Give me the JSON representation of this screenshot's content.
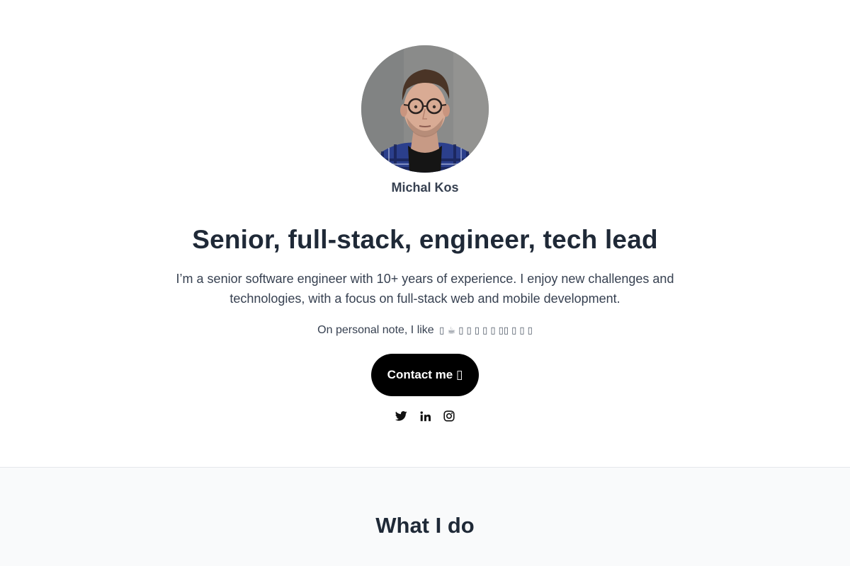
{
  "profile": {
    "name": "Michal Kos"
  },
  "hero": {
    "headline": "Senior, full-stack, engineer, tech lead",
    "intro": "I’m a senior software engineer with 10+ years of experience. I enjoy new challenges and technologies, with a focus on full-stack web and mobile development.",
    "personal_prefix": "On personal note, I like",
    "personal_emojis": "▯ ☕ ▯ ▯ ▯ ▯ ▯ ▯▯ ▯ ▯ ▯"
  },
  "cta": {
    "contact_label": "Contact me ▯"
  },
  "social": {
    "icons": [
      "twitter-icon",
      "linkedin-icon",
      "instagram-icon"
    ]
  },
  "sections": {
    "what_i_do_title": "What I do"
  },
  "colors": {
    "button_bg": "#000000",
    "button_text": "#ffffff",
    "heading": "#1f2937",
    "body_text": "#374151",
    "section_bg": "#f9fafb",
    "divider": "#e5e7eb"
  }
}
